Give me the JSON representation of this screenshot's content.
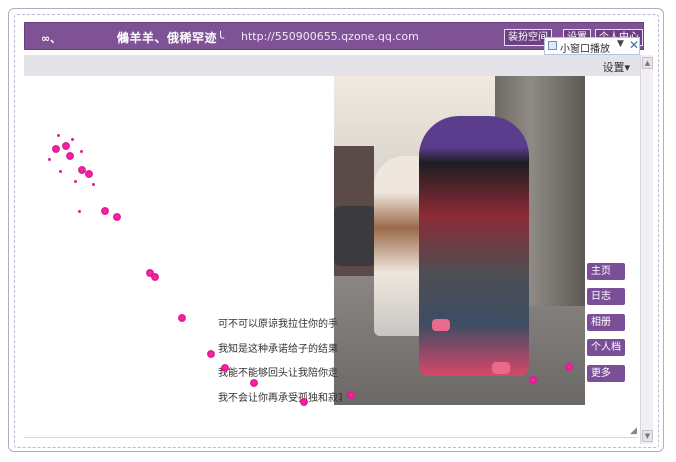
{
  "header": {
    "symbol": "∞、",
    "blog_name": "鵂羊羊、俄稀罕迹╰",
    "url": "http://550900655.qzone.qq.com",
    "buttons": [
      "装扮空间",
      "设置",
      "个人中心"
    ]
  },
  "mini_player": {
    "label": "小窗口播放",
    "dropdown": "▼",
    "close": "✕"
  },
  "settings": {
    "label": "设置▾"
  },
  "nav": [
    "主页",
    "日志",
    "相册",
    "个人档",
    "更多"
  ],
  "lyrics": [
    "可不可以原谅我拉住你的手",
    "我知是这种承诺给子的结果",
    "我能不能够回头让我陪你走",
    "我不会让你再承受孤独和寂寞"
  ],
  "icons": {
    "play": "play-icon",
    "close": "close-icon",
    "scroll_up": "▲",
    "scroll_down": "▼",
    "resize": "◢"
  },
  "colors": {
    "accent": "#7f5296",
    "nav": "#7b4f98",
    "sparkle": "#e2168f"
  }
}
